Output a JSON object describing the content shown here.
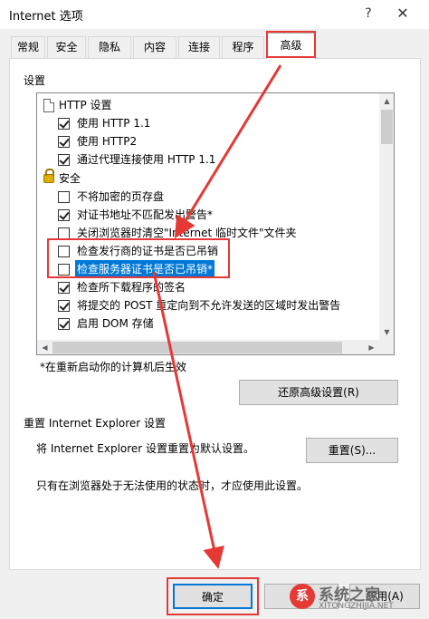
{
  "window": {
    "title": "Internet 选项",
    "help": "?",
    "close": "✕"
  },
  "tabs": [
    {
      "label": "常规"
    },
    {
      "label": "安全"
    },
    {
      "label": "隐私"
    },
    {
      "label": "内容"
    },
    {
      "label": "连接"
    },
    {
      "label": "程序"
    },
    {
      "label": "高级",
      "active": true
    }
  ],
  "settings": {
    "label": "设置",
    "items": [
      {
        "type": "group",
        "icon": "document-icon",
        "label": "HTTP 设置"
      },
      {
        "type": "check",
        "checked": true,
        "label": "使用 HTTP 1.1"
      },
      {
        "type": "check",
        "checked": true,
        "label": "使用 HTTP2"
      },
      {
        "type": "check",
        "checked": true,
        "label": "通过代理连接使用 HTTP 1.1"
      },
      {
        "type": "group",
        "icon": "lock-icon",
        "label": "安全"
      },
      {
        "type": "check",
        "checked": false,
        "label": "不将加密的页存盘"
      },
      {
        "type": "check",
        "checked": true,
        "label": "对证书地址不匹配发出警告*"
      },
      {
        "type": "check",
        "checked": false,
        "label": "关闭浏览器时清空\"Internet 临时文件\"文件夹"
      },
      {
        "type": "check",
        "checked": false,
        "label": "检查发行商的证书是否已吊销"
      },
      {
        "type": "check",
        "checked": false,
        "label": "检查服务器证书是否已吊销*",
        "selected": true
      },
      {
        "type": "check",
        "checked": true,
        "label": "检查所下载程序的签名"
      },
      {
        "type": "check",
        "checked": true,
        "label": "将提交的 POST 重定向到不允许发送的区域时发出警告"
      },
      {
        "type": "check",
        "checked": true,
        "label": "启用 DOM 存储"
      }
    ]
  },
  "restart_note": "*在重新启动你的计算机后生效",
  "restore_button": "还原高级设置(R)",
  "reset_section": {
    "label": "重置 Internet Explorer 设置",
    "description": "将 Internet Explorer 设置重置为默认设置。",
    "button": "重置(S)...",
    "note": "只有在浏览器处于无法使用的状态时，才应使用此设置。"
  },
  "footer": {
    "ok": "确定",
    "cancel": "取消",
    "apply": "应用(A)"
  },
  "watermark": {
    "logo": "系",
    "text": "系统之家",
    "url": "XITONGZHIJIA.NET"
  },
  "colors": {
    "annotation": "#e53935",
    "selection": "#0078d7"
  }
}
